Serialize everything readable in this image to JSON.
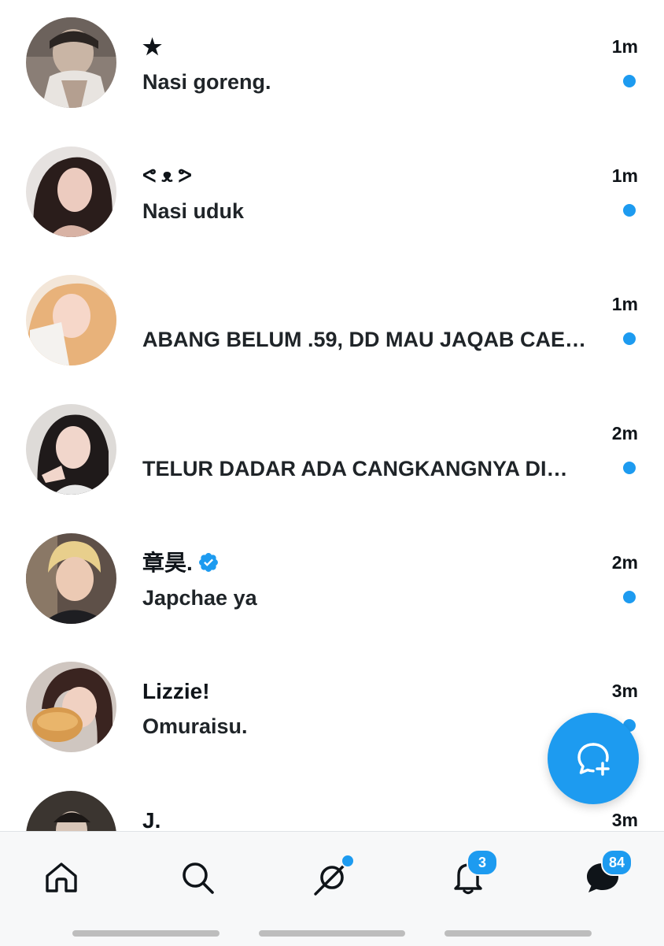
{
  "conversations": [
    {
      "name": "★",
      "message": "Nasi goreng.",
      "time": "1m",
      "unread": true,
      "verified": false
    },
    {
      "name": "ᕙ ᴥ ᕗ",
      "message": "Nasi uduk",
      "time": "1m",
      "unread": true,
      "verified": false
    },
    {
      "name": "",
      "message": "ABANG BELUM .59, DD MAU JAQAB CAE…",
      "time": "1m",
      "unread": true,
      "verified": false
    },
    {
      "name": "",
      "message": "TELUR DADAR ADA CANGKANGNYA DI…",
      "time": "2m",
      "unread": true,
      "verified": false
    },
    {
      "name": "章昊.",
      "message": "Japchae ya",
      "time": "2m",
      "unread": true,
      "verified": true
    },
    {
      "name": "Lizzie!",
      "message": "Omuraisu.",
      "time": "3m",
      "unread": true,
      "verified": false
    },
    {
      "name": "J.",
      "message": "",
      "time": "3m",
      "unread": false,
      "verified": false
    }
  ],
  "colors": {
    "accent": "#1d9bf0",
    "text": "#0f1419",
    "tabbar_bg": "#f7f8f9"
  },
  "fab": {
    "icon": "new-message-icon"
  },
  "tabbar": {
    "home_icon": "home-icon",
    "search_icon": "search-icon",
    "grok_icon": "grok-icon",
    "notifications_icon": "bell-icon",
    "notifications_badge": "3",
    "messages_icon": "message-icon",
    "messages_badge": "84"
  }
}
